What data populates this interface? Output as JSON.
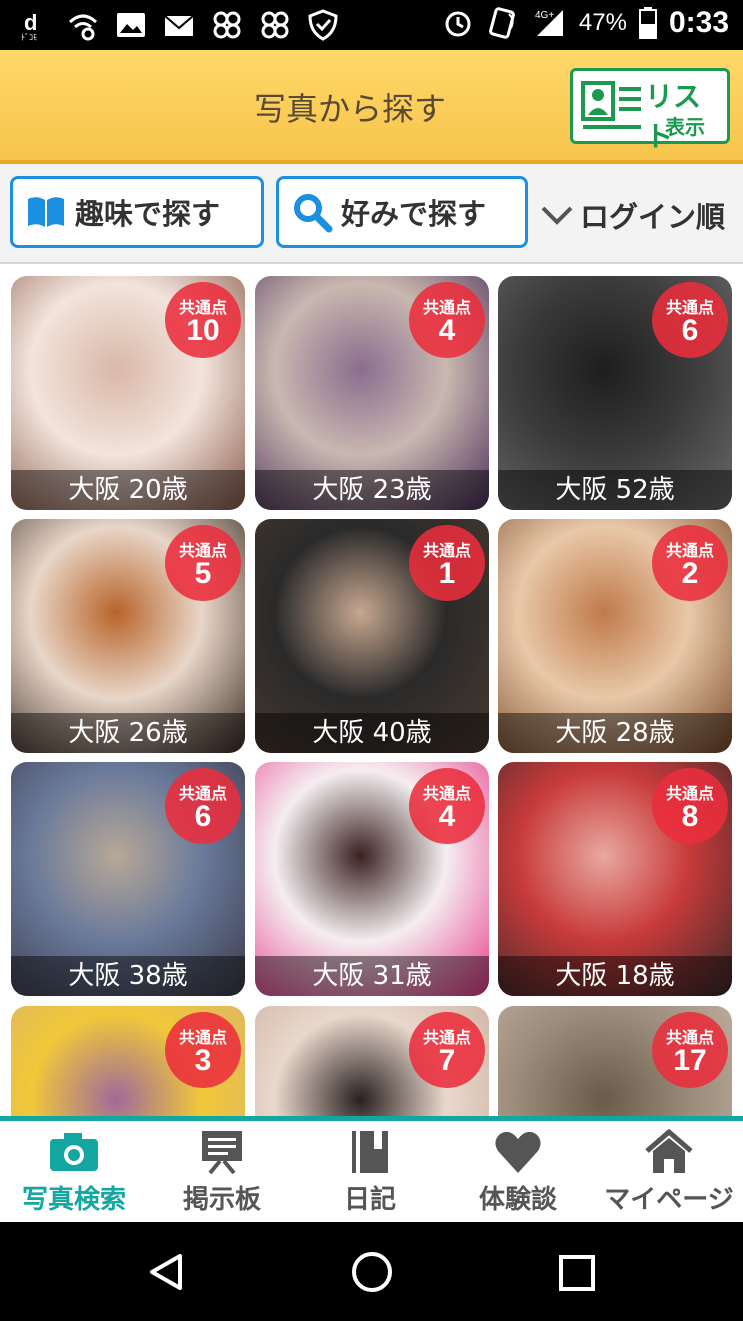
{
  "status_bar": {
    "battery_percent": "47%",
    "time": "0:33",
    "network": "4G+",
    "icons": [
      "docomo-icon",
      "wifi-settings-icon",
      "image-icon",
      "mail-icon",
      "app-icon",
      "app-icon",
      "shield-icon",
      "alarm-icon",
      "nfc-icon",
      "signal-icon",
      "battery-icon"
    ]
  },
  "header": {
    "title": "写真から探す",
    "list_button": {
      "label_top": "リスト",
      "label_bottom": "表示"
    }
  },
  "filters": {
    "hobby_button": "趣味で探す",
    "preference_button": "好みで探す",
    "sort_label": "ログイン順"
  },
  "badge_label": "共通点",
  "cards": [
    {
      "caption": "大阪 20歳",
      "common_points": "10",
      "colors": [
        "#f2e4dc",
        "#d9b8a8",
        "#8a5a4a"
      ]
    },
    {
      "caption": "大阪 23歳",
      "common_points": "4",
      "colors": [
        "#c9b8b0",
        "#8a6d8e",
        "#4a2e5a"
      ]
    },
    {
      "caption": "大阪 52歳",
      "common_points": "6",
      "colors": [
        "#3a3a3a",
        "#1e1e1e",
        "#6a6a6a"
      ]
    },
    {
      "caption": "大阪 26歳",
      "common_points": "5",
      "colors": [
        "#e8d6c8",
        "#b8642a",
        "#3a2a22"
      ]
    },
    {
      "caption": "大阪 40歳",
      "common_points": "1",
      "colors": [
        "#2a2a2a",
        "#c8a890",
        "#4a3a30"
      ]
    },
    {
      "caption": "大阪 28歳",
      "common_points": "2",
      "colors": [
        "#e8c8a8",
        "#c07a4a",
        "#7a4a2a"
      ]
    },
    {
      "caption": "大阪 38歳",
      "common_points": "6",
      "colors": [
        "#6a7a9a",
        "#b8a898",
        "#3a3a4a"
      ]
    },
    {
      "caption": "大阪 31歳",
      "common_points": "4",
      "colors": [
        "#f4eef0",
        "#3a2220",
        "#e83a8a"
      ]
    },
    {
      "caption": "大阪 18歳",
      "common_points": "8",
      "colors": [
        "#c83a3a",
        "#e8a8a0",
        "#3a2a2a"
      ]
    },
    {
      "caption": "",
      "common_points": "3",
      "colors": [
        "#f0c83a",
        "#a06a9a",
        "#d8b070"
      ]
    },
    {
      "caption": "",
      "common_points": "7",
      "colors": [
        "#e8d8cc",
        "#2a2020",
        "#c8a898"
      ]
    },
    {
      "caption": "",
      "common_points": "17",
      "colors": [
        "#9a8a7a",
        "#6a5a4a",
        "#c8b8a8"
      ]
    }
  ],
  "tabs": [
    {
      "label": "写真検索",
      "icon": "camera-icon",
      "active": true
    },
    {
      "label": "掲示板",
      "icon": "board-icon",
      "active": false
    },
    {
      "label": "日記",
      "icon": "diary-icon",
      "active": false
    },
    {
      "label": "体験談",
      "icon": "heart-icon",
      "active": false
    },
    {
      "label": "マイページ",
      "icon": "home-icon",
      "active": false
    }
  ],
  "colors": {
    "header_yellow": "#f6c44a",
    "accent_green": "#1b9a4f",
    "filter_blue": "#1b8fe0",
    "tab_teal": "#14a7a1",
    "badge_red": "#eb2d3c"
  }
}
